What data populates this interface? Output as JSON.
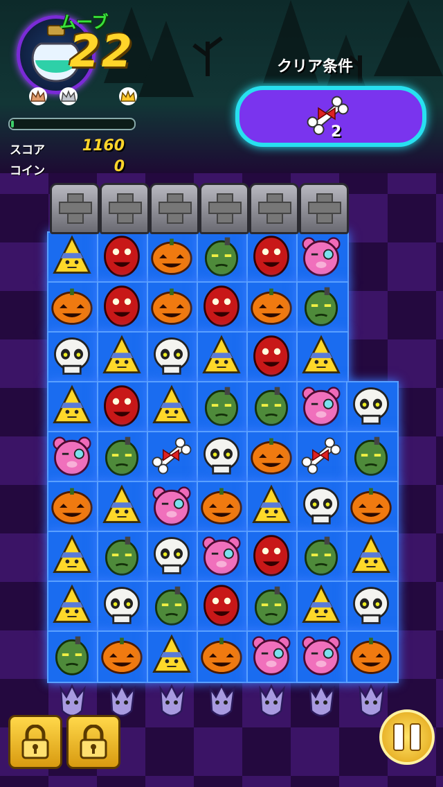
{
  "hud": {
    "moves_label": "ムーブ",
    "moves_value": "22",
    "score_label": "スコア",
    "score_value": "1160",
    "coin_label": "コイン",
    "coin_value": "0",
    "progress_fraction": 0.02,
    "crowns": [
      "bronze-crown-icon",
      "silver-crown-icon",
      "gold-crown-icon"
    ]
  },
  "goal": {
    "label": "クリア条件",
    "item_icon": "bone-ribbon-icon",
    "count": "2"
  },
  "board": {
    "rows": [
      [
        "candy",
        "redball",
        "pumpkin",
        "zombie",
        "redball",
        "bear",
        null
      ],
      [
        "pumpkin",
        "redball",
        "pumpkin",
        "redball",
        "pumpkin",
        "zombie",
        null
      ],
      [
        "skull",
        "candy",
        "skull",
        "candy",
        "redball",
        "candy",
        null
      ],
      [
        "candy",
        "redball",
        "candy",
        "zombie",
        "zombie",
        "bear",
        "skull"
      ],
      [
        "bear",
        "zombie",
        "bone",
        "skull",
        "pumpkin",
        "bone",
        "zombie"
      ],
      [
        "pumpkin",
        "candy",
        "bear",
        "pumpkin",
        "candy",
        "skull",
        "pumpkin"
      ],
      [
        "candy",
        "zombie",
        "skull",
        "bear",
        "redball",
        "zombie",
        "candy"
      ],
      [
        "candy",
        "skull",
        "zombie",
        "redball",
        "zombie",
        "candy",
        "skull"
      ],
      [
        "zombie",
        "pumpkin",
        "candy",
        "pumpkin",
        "bear",
        "bear",
        "pumpkin"
      ]
    ],
    "tombstones": 6,
    "ghosts": 7
  },
  "controls": {
    "lock_buttons": [
      "lock-icon",
      "lock-icon"
    ],
    "pause_icon": "pause-icon"
  },
  "colors": {
    "accent": "#28e0f0",
    "board": "#1a6cf0",
    "score": "#ffd52a"
  }
}
